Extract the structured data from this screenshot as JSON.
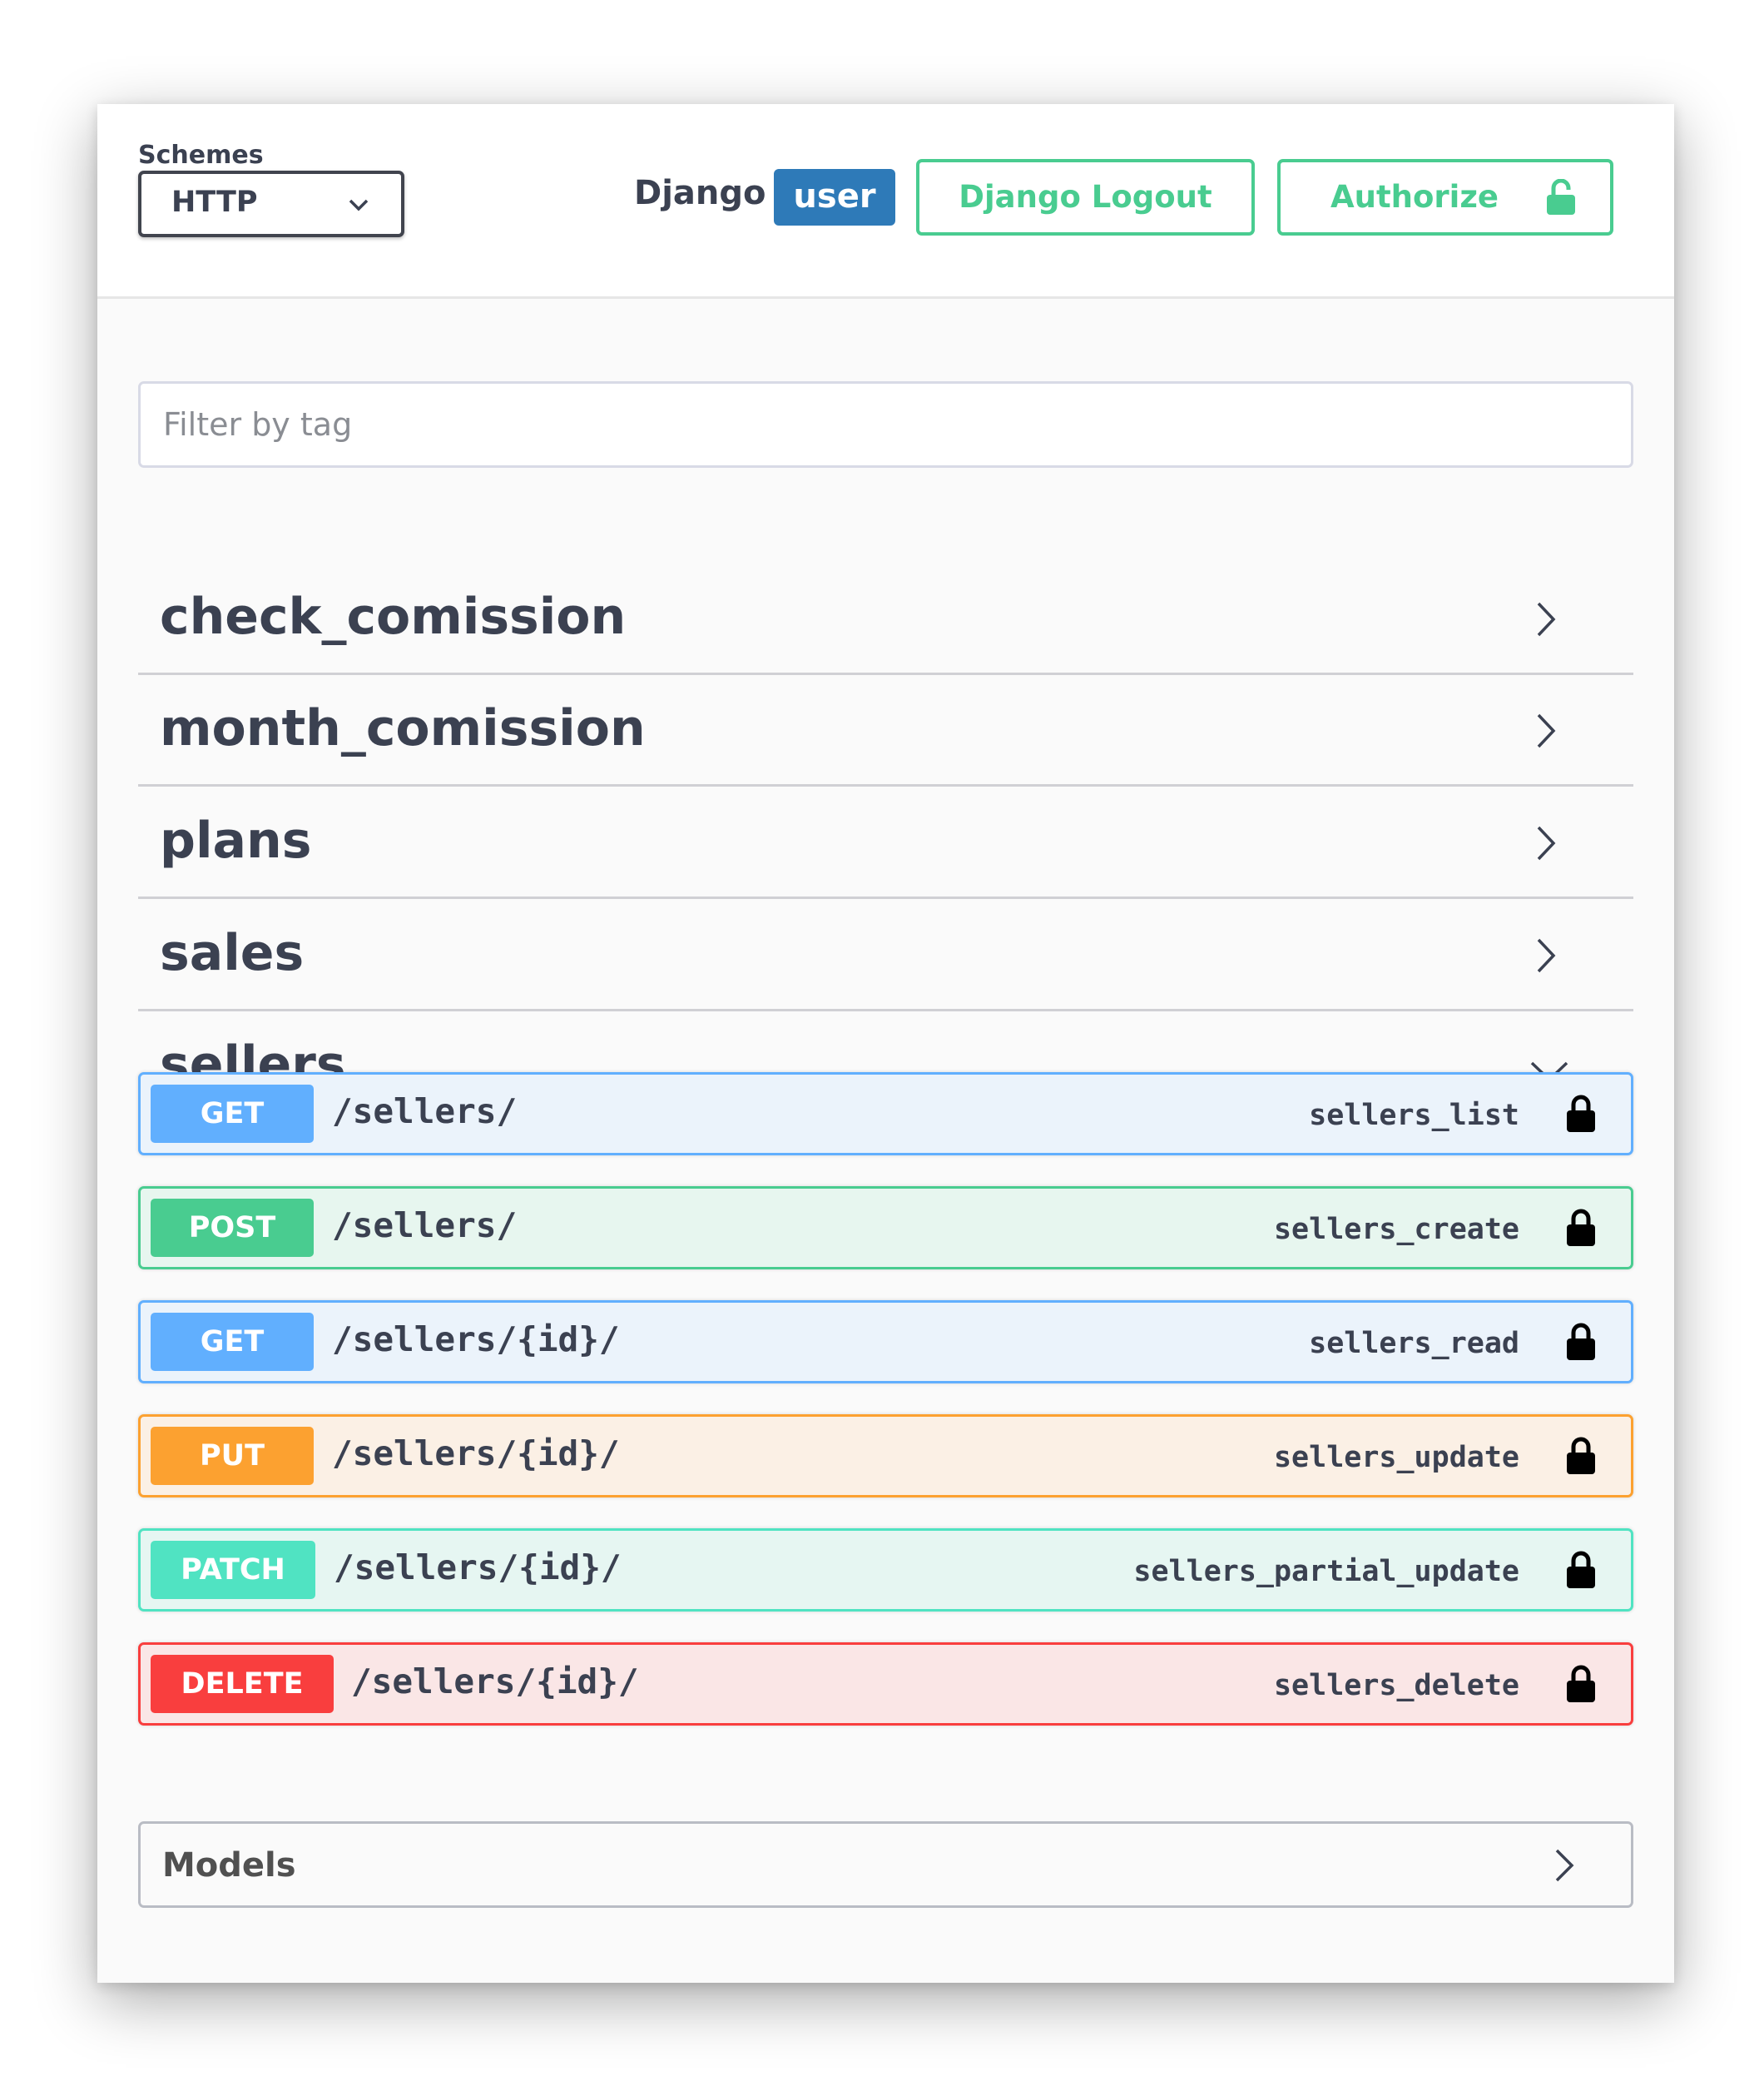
{
  "header": {
    "schemes_label": "Schemes",
    "scheme_selected": "HTTP",
    "django_label": "Django",
    "user_badge": "user",
    "logout_label": "Django Logout",
    "authorize_label": "Authorize"
  },
  "filter": {
    "placeholder": "Filter by tag",
    "value": ""
  },
  "tags": [
    {
      "name": "check_comission",
      "expanded": false
    },
    {
      "name": "month_comission",
      "expanded": false
    },
    {
      "name": "plans",
      "expanded": false
    },
    {
      "name": "sales",
      "expanded": false
    },
    {
      "name": "sellers",
      "expanded": true
    }
  ],
  "operations": [
    {
      "method": "GET",
      "path": "/sellers/",
      "operation_id": "sellers_list"
    },
    {
      "method": "POST",
      "path": "/sellers/",
      "operation_id": "sellers_create"
    },
    {
      "method": "GET",
      "path": "/sellers/{id}/",
      "operation_id": "sellers_read"
    },
    {
      "method": "PUT",
      "path": "/sellers/{id}/",
      "operation_id": "sellers_update"
    },
    {
      "method": "PATCH",
      "path": "/sellers/{id}/",
      "operation_id": "sellers_partial_update"
    },
    {
      "method": "DELETE",
      "path": "/sellers/{id}/",
      "operation_id": "sellers_delete"
    }
  ],
  "models": {
    "label": "Models"
  },
  "colors": {
    "accent_green": "#49cc90",
    "user_badge": "#2e7ab8",
    "get": "#61affe",
    "post": "#49cc90",
    "put": "#fca130",
    "patch": "#50e3c2",
    "delete": "#f93e3e",
    "text": "#3b4151"
  },
  "icons": {
    "scheme_select": "chevron-down-icon",
    "authorize": "lock-open-icon",
    "tag_collapsed": "chevron-right-icon",
    "tag_expanded": "chevron-down-icon",
    "operation": "lock-icon",
    "models": "chevron-right-icon"
  }
}
